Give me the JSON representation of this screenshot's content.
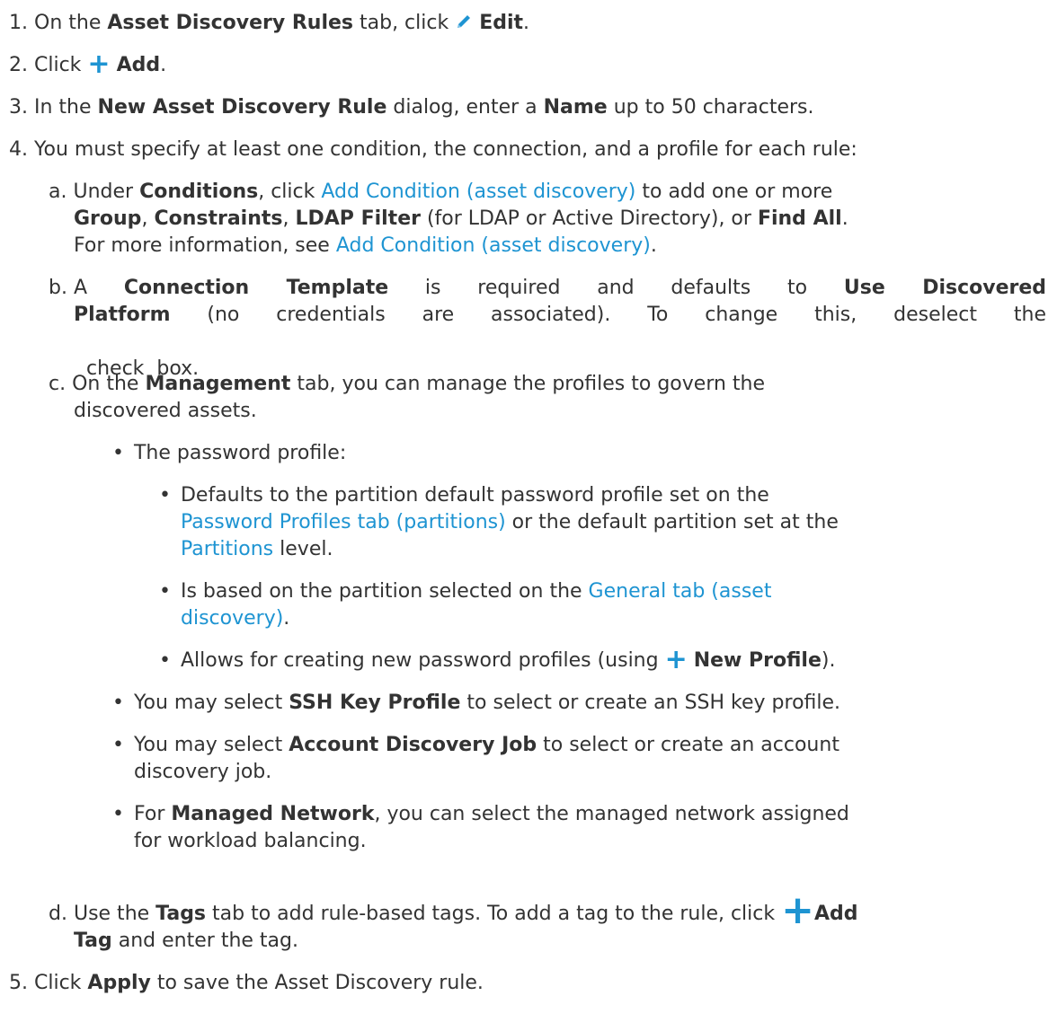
{
  "steps": [
    {
      "num": "1.",
      "t1": "On the ",
      "b1": "Asset Discovery Rules",
      "t2": " tab, click ",
      "icon": "pencil-icon",
      "b2": "Edit",
      "t3": "."
    },
    {
      "num": "2.",
      "t1": "Click ",
      "icon": "plus-icon",
      "b1": "Add",
      "t2": "."
    },
    {
      "num": "3.",
      "t1": "In the ",
      "b1": "New Asset Discovery Rule",
      "t2": " dialog, enter a ",
      "b2": "Name",
      "t3": " up to 50 characters."
    },
    {
      "num": "4.",
      "t1": "You must specify at least one condition, the connection, and a profile for each rule:"
    },
    {
      "num": "5.",
      "t1": "Click ",
      "b1": "Apply",
      "t2": " to save the Asset Discovery rule."
    }
  ],
  "sub_a": {
    "letter": "a.",
    "t1": "Under ",
    "b1": "Conditions",
    "t2": ", click ",
    "link1": "Add Condition (asset discovery)",
    "t3": " to add one or more",
    "b2": "Group",
    "t4": ", ",
    "b3": "Constraints",
    "t5": ", ",
    "b4": "LDAP Filter",
    "t6": " (for LDAP or Active Directory), or ",
    "b5": "Find All",
    "t7": ".",
    "t8": "For more information, see ",
    "link2": "Add Condition (asset discovery)",
    "t9": "."
  },
  "sub_b": {
    "letter": "b.",
    "line1_t1": "A ",
    "line1_b1": "Connection Template",
    "line1_t2": " is required and defaults to ",
    "line1_b2": "Use Discovered",
    "line2_b1": "Platform",
    "line2_t1": " (no credentials are associated). To change this, deselect the",
    "line3_t1": "check  box."
  },
  "sub_c": {
    "letter": "c.",
    "t1": "On the ",
    "b1": "Management",
    "t2": " tab, you can manage the profiles to govern the",
    "t3": "discovered assets.",
    "bullet_password": "The password profile:",
    "pw1_t1": "Defaults to the partition default password profile set on the",
    "pw1_link1": "Password Profiles tab (partitions)",
    "pw1_t2": " or the default partition set at the",
    "pw1_link2": "Partitions",
    "pw1_t3": " level.",
    "pw2_t1": "Is based on the partition selected on the ",
    "pw2_link1": "General tab (asset",
    "pw2_link2": "discovery)",
    "pw2_t2": ".",
    "pw3_t1": "Allows for creating new password profiles (using ",
    "pw3_icon": "plus-icon",
    "pw3_b1": "New Profile",
    "pw3_t2": ").",
    "ssh_t1": "You may select ",
    "ssh_b1": "SSH Key Profile",
    "ssh_t2": " to select or create an SSH key profile.",
    "adj_t1": "You may select ",
    "adj_b1": "Account Discovery Job",
    "adj_t2": " to select or create an account",
    "adj_t3": "discovery job.",
    "mn_t1": "For ",
    "mn_b1": "Managed Network",
    "mn_t2": ", you can select the managed network assigned",
    "mn_t3": "for workload balancing."
  },
  "sub_d": {
    "letter": "d.",
    "t1": "Use the ",
    "b1": "Tags",
    "t2": " tab to add rule-based tags. To add a tag to the rule, click ",
    "icon": "plus-icon",
    "b2": "Add",
    "b3": "Tag",
    "t3": " and enter the tag."
  },
  "colors": {
    "text": "#333333",
    "link": "#1e94d2",
    "icon": "#1e94d2"
  },
  "bullet_char": "•",
  "plus_char": "+"
}
